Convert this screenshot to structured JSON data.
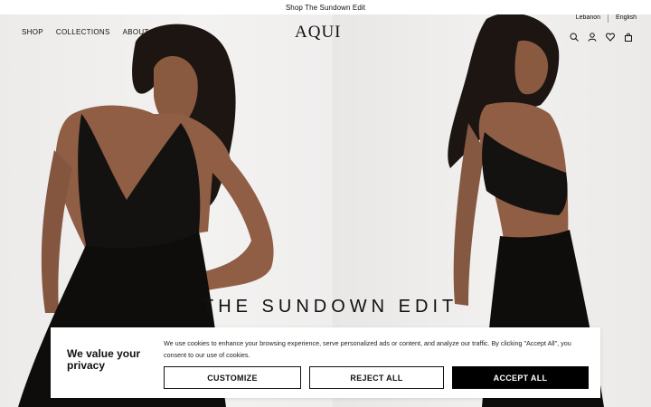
{
  "announcement": {
    "text": "Shop The Sundown Edit"
  },
  "header": {
    "nav": [
      "SHOP",
      "COLLECTIONS",
      "ABOUT"
    ],
    "logo": "AQUI",
    "locale": {
      "country": "Lebanon",
      "language": "English"
    },
    "icons": [
      "search-icon",
      "account-icon",
      "wishlist-icon",
      "cart-icon"
    ]
  },
  "hero": {
    "title": "THE SUNDOWN EDIT"
  },
  "cookie": {
    "title": "We value your privacy",
    "text": "We use cookies to enhance your browsing experience, serve personalized ads or content, and analyze our traffic. By clicking \"Accept All\", you consent to our use of cookies.",
    "customize": "CUSTOMIZE",
    "reject": "REJECT ALL",
    "accept": "ACCEPT ALL"
  },
  "colors": {
    "accent": "#000000",
    "background": "#ffffff"
  }
}
